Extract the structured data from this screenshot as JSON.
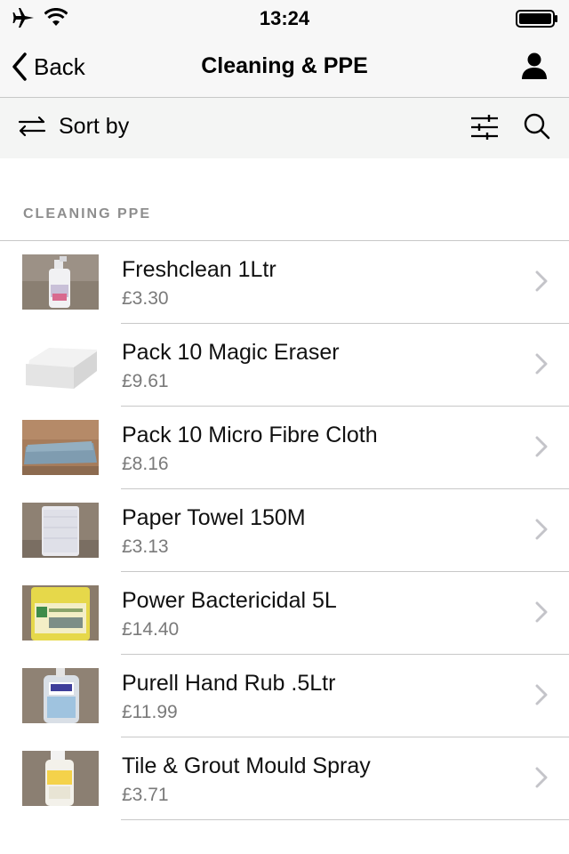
{
  "status_bar": {
    "time": "13:24",
    "icons": [
      "airplane-icon",
      "wifi-icon",
      "battery-icon"
    ]
  },
  "nav": {
    "back_label": "Back",
    "title": "Cleaning & PPE",
    "right_icon": "person-icon"
  },
  "toolbar": {
    "sort_label": "Sort by",
    "icons": [
      "sort-arrows-icon",
      "filter-sliders-icon",
      "search-icon"
    ]
  },
  "section": {
    "header": "CLEANING PPE"
  },
  "products": [
    {
      "name": "Freshclean 1Ltr",
      "price": "£3.30"
    },
    {
      "name": "Pack 10 Magic Eraser",
      "price": "£9.61"
    },
    {
      "name": "Pack 10 Micro Fibre Cloth",
      "price": "£8.16"
    },
    {
      "name": "Paper Towel 150M",
      "price": "£3.13"
    },
    {
      "name": "Power Bactericidal 5L",
      "price": "£14.40"
    },
    {
      "name": "Purell Hand Rub .5Ltr",
      "price": "£11.99"
    },
    {
      "name": "Tile & Grout Mould Spray",
      "price": "£3.71"
    }
  ],
  "colors": {
    "bar_background": "#f7f7f7",
    "separator": "#c8c8c8",
    "section_header": "#8e8e8e",
    "price_text": "#7a7a7a",
    "chevron": "#c4c4c9"
  }
}
